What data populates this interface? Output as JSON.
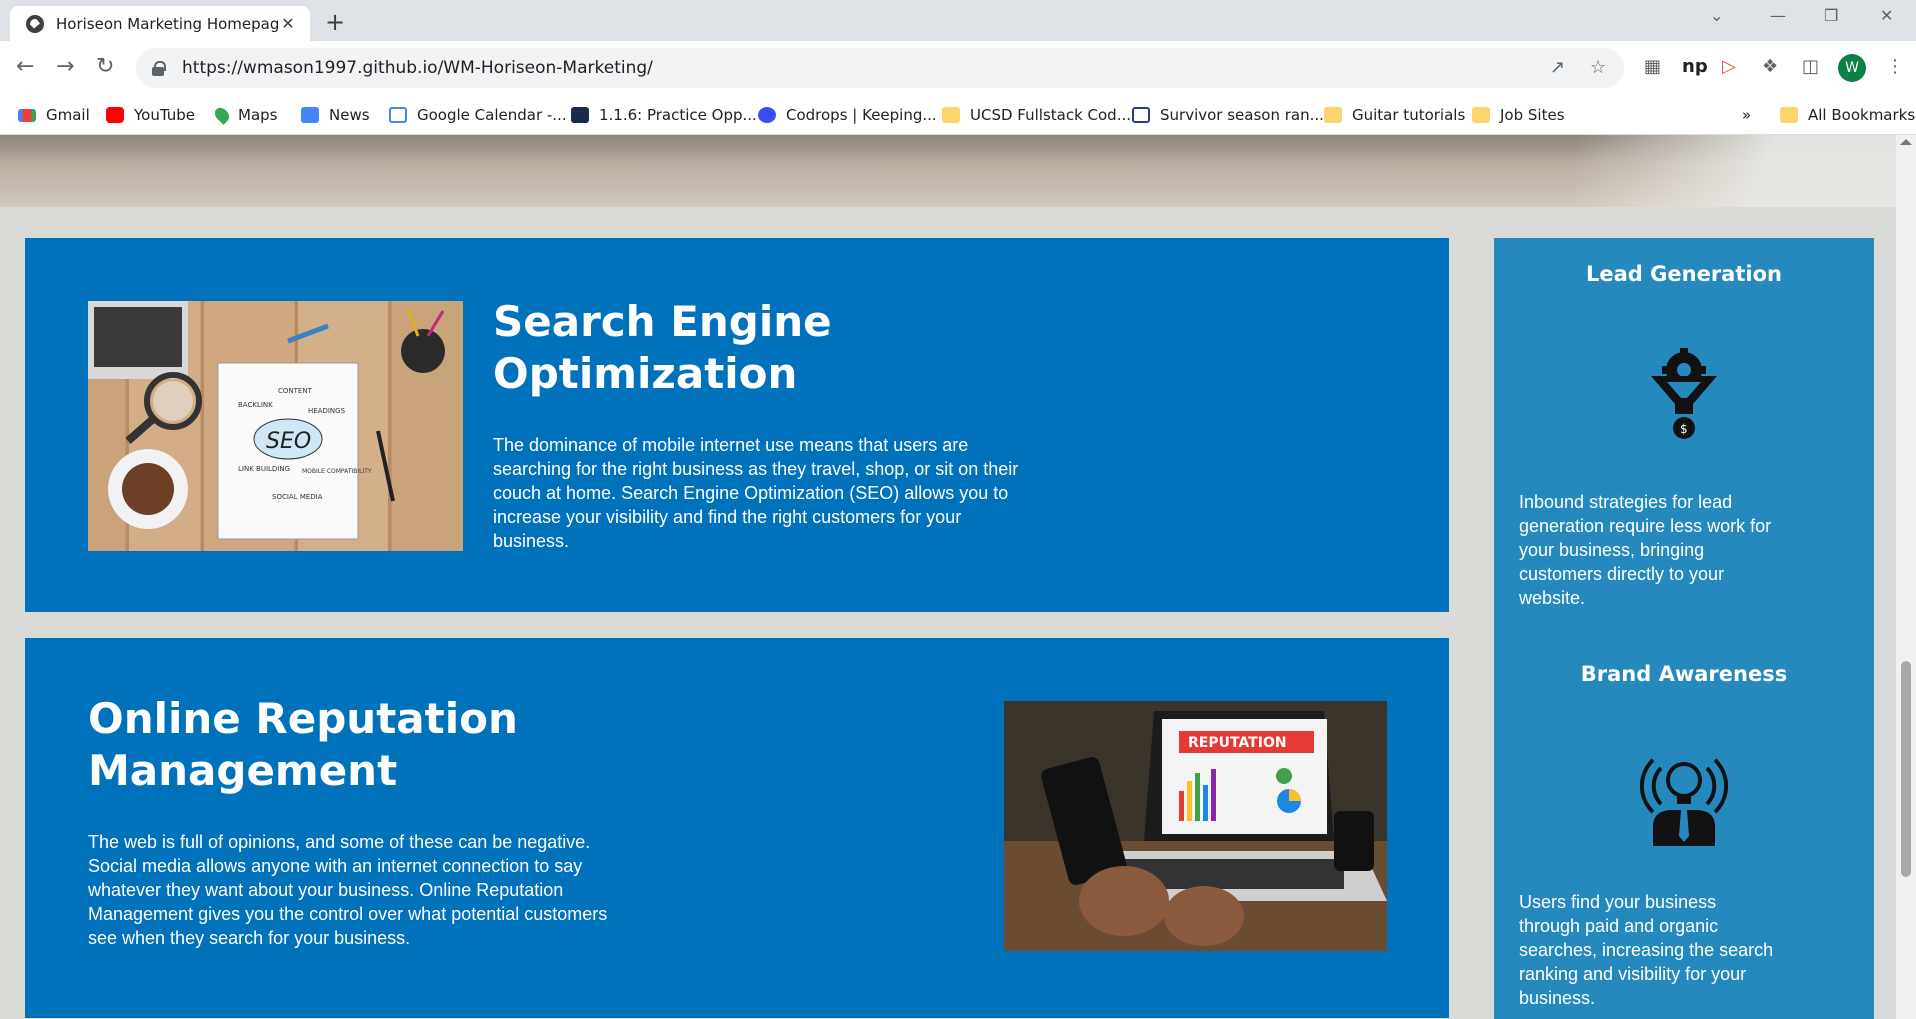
{
  "browser": {
    "tab_title": "Horiseon Marketing Homepage",
    "tab_close": "✕",
    "new_tab": "+",
    "url": "https://wmason1997.github.io/WM-Horiseon-Marketing/",
    "avatar_letter": "W",
    "bookmarks": [
      {
        "label": "Gmail",
        "color": "#ea4335"
      },
      {
        "label": "YouTube",
        "color": "#ff0000"
      },
      {
        "label": "Maps",
        "color": "#34a853"
      },
      {
        "label": "News",
        "color": "#4285f4"
      },
      {
        "label": "Google Calendar -...",
        "color": "#4285f4"
      },
      {
        "label": "1.1.6: Practice Opp...",
        "color": "#1a2a4a"
      },
      {
        "label": "Codrops | Keeping...",
        "color": "#3a4ef0"
      },
      {
        "label": "UCSD Fullstack Cod...",
        "color": "#fbd46d"
      },
      {
        "label": "Survivor season ran...",
        "color": "#2b3a8c"
      },
      {
        "label": "Guitar tutorials",
        "color": "#fbd46d"
      },
      {
        "label": "Job Sites",
        "color": "#fbd46d"
      }
    ],
    "more_bookmarks": "»",
    "all_bookmarks": "All Bookmarks"
  },
  "content": {
    "seo": {
      "heading": "Search Engine Optimization",
      "body": "The dominance of mobile internet use means that users are searching for the right business as they travel, shop, or sit on their couch at home. Search Engine Optimization (SEO) allows you to increase your visibility and find the right customers for your business.",
      "image_words": [
        "CONTENT",
        "BACKLINK",
        "HEADINGS",
        "SEO",
        "LINK BUILDING",
        "MOBILE COMPATIBILITY",
        "SOCIAL MEDIA"
      ]
    },
    "reputation": {
      "heading": "Online Reputation Management",
      "body": "The web is full of opinions, and some of these can be negative. Social media allows anyone with an internet connection to say whatever they want about your business. Online Reputation Management gives you the control over what potential customers see when they search for your business.",
      "image_word": "REPUTATION"
    }
  },
  "benefits": [
    {
      "title": "Lead Generation",
      "body": "Inbound strategies for lead generation require less work for your business, bringing customers directly to your website."
    },
    {
      "title": "Brand Awareness",
      "body": "Users find your business through paid and organic searches, increasing the search ranking and visibility for your business."
    }
  ]
}
